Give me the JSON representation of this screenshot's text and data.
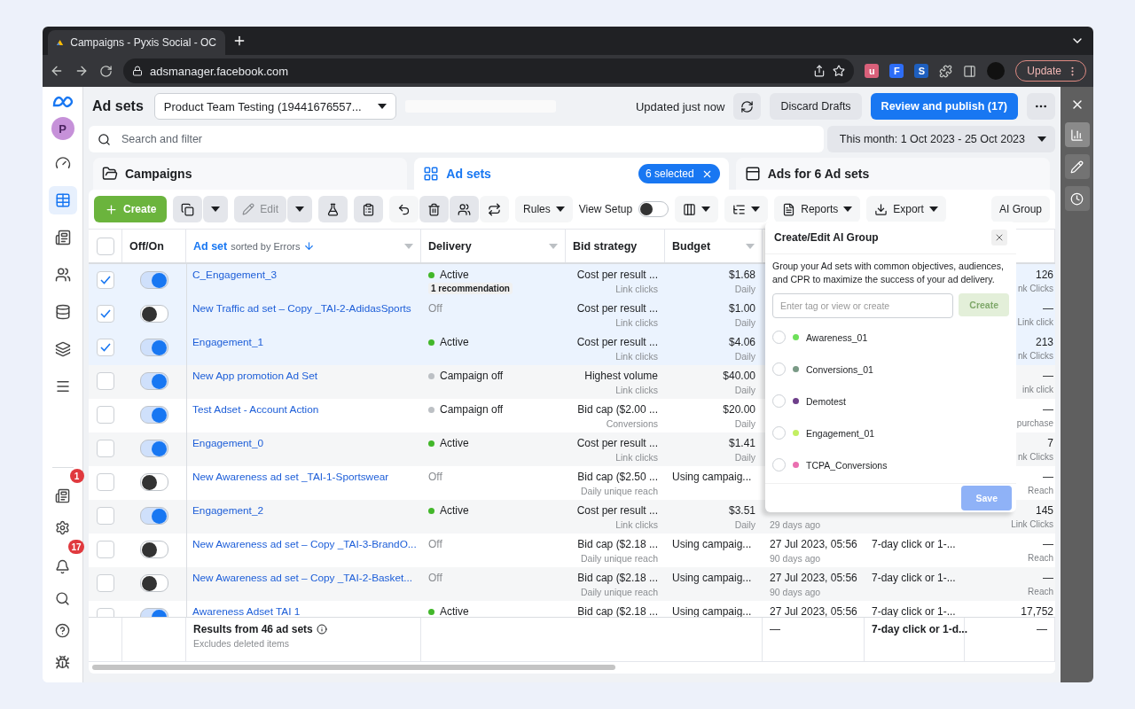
{
  "browser": {
    "tab_title": "Campaigns - Pyxis Social - OC",
    "url": "adsmanager.facebook.com",
    "extensions": [
      {
        "letter": "u",
        "color": "#d9607a"
      },
      {
        "letter": "F",
        "color": "#2d6df6"
      },
      {
        "letter": "S",
        "color": "#1e5fbf"
      }
    ],
    "update_label": "Update"
  },
  "left_nav": {
    "avatar": "P",
    "items": [
      {
        "kind": "gauge",
        "selected": false
      },
      {
        "kind": "table",
        "selected": true
      },
      {
        "kind": "news",
        "selected": false
      },
      {
        "kind": "people",
        "selected": false
      },
      {
        "kind": "coins",
        "selected": false
      },
      {
        "kind": "layers",
        "selected": false
      },
      {
        "kind": "menu",
        "selected": false
      }
    ],
    "bottom": [
      {
        "kind": "news",
        "badge": "1"
      },
      {
        "kind": "gear"
      },
      {
        "kind": "bell",
        "badge": "17"
      },
      {
        "kind": "search"
      },
      {
        "kind": "help"
      },
      {
        "kind": "bug"
      }
    ]
  },
  "top_bar": {
    "title": "Ad sets",
    "account": "Product Team Testing (19441676557...",
    "status": "Updated just now",
    "discard": "Discard Drafts",
    "publish": "Review and publish (17)"
  },
  "search": {
    "placeholder": "Search and filter",
    "date_range": "This month: 1 Oct 2023 - 25 Oct 2023"
  },
  "tabs": [
    {
      "label": "Campaigns",
      "kind": "campaigns",
      "selected": false
    },
    {
      "label": "Ad sets",
      "kind": "adsets",
      "selected": true,
      "pill": "6 selected"
    },
    {
      "label": "Ads for 6 Ad sets",
      "kind": "ads",
      "selected": false
    }
  ],
  "toolbar": {
    "create": "Create",
    "edit": "Edit",
    "rules": "Rules",
    "view_setup": {
      "label": "View Setup",
      "on": false
    },
    "reports": "Reports",
    "export": "Export",
    "ai_group": "AI Group"
  },
  "table": {
    "all_selected": false,
    "columns": [
      {
        "label": "Off/On"
      },
      {
        "label": "Ad set",
        "note": "sorted by Errors"
      },
      {
        "label": "Delivery"
      },
      {
        "label": "Bid strategy"
      },
      {
        "label": "Budget"
      }
    ],
    "rows": [
      {
        "selected": true,
        "on": true,
        "name": "C_Engagement_3",
        "kind": "active",
        "delivery": "Active",
        "recommendation": "1 recommendation",
        "bid": "Cost per result ...",
        "bid_sub": "Link clicks",
        "budget": "$1.68",
        "budget_sub": "Daily",
        "results": "126",
        "results_sub": "nk Clicks"
      },
      {
        "selected": true,
        "on": false,
        "name": "New Traffic ad set – Copy _TAI-2-AdidasSports",
        "kind": "off",
        "delivery": "Off",
        "bid": "Cost per result ...",
        "bid_sub": "Link clicks",
        "budget": "$1.00",
        "budget_sub": "Daily",
        "results": "—",
        "results_sub": "Link click"
      },
      {
        "selected": true,
        "on": true,
        "name": "Engagement_1",
        "kind": "active",
        "delivery": "Active",
        "bid": "Cost per result ...",
        "bid_sub": "Link clicks",
        "budget": "$4.06",
        "budget_sub": "Daily",
        "results": "213",
        "results_sub": "nk Clicks"
      },
      {
        "selected": false,
        "on": true,
        "name": "New App promotion Ad Set",
        "kind": "campaign_off",
        "delivery": "Campaign off",
        "bid": "Highest volume",
        "bid_sub": "Link clicks",
        "budget": "$40.00",
        "budget_sub": "Daily",
        "results": "—",
        "results_sub": "ink click"
      },
      {
        "selected": false,
        "on": true,
        "name": "Test Adset - Account Action",
        "kind": "campaign_off",
        "delivery": "Campaign off",
        "bid": "Bid cap ($2.00 ...",
        "bid_sub": "Conversions",
        "budget": "$20.00",
        "budget_sub": "Daily",
        "results": "—",
        "results_sub": "purchase"
      },
      {
        "selected": false,
        "on": true,
        "name": "Engagement_0",
        "kind": "active",
        "delivery": "Active",
        "bid": "Cost per result ...",
        "bid_sub": "Link clicks",
        "budget": "$1.41",
        "budget_sub": "Daily",
        "results": "7",
        "results_sub": "nk Clicks"
      },
      {
        "selected": false,
        "on": false,
        "name": "New Awareness ad set _TAI-1-Sportswear",
        "kind": "off",
        "delivery": "Off",
        "bid": "Bid cap ($2.50 ...",
        "bid_sub": "Daily unique reach",
        "budget": "Using campaig...",
        "results": "—",
        "results_sub": "Reach"
      },
      {
        "selected": false,
        "on": true,
        "name": "Engagement_2",
        "kind": "active",
        "delivery": "Active",
        "bid": "Cost per result ...",
        "bid_sub": "Link clicks",
        "budget": "$3.51",
        "budget_sub": "Daily",
        "date_sub": "29 days ago",
        "results": "145",
        "results_sub": "Link Clicks"
      },
      {
        "selected": false,
        "on": false,
        "name": "New Awareness ad set – Copy _TAI-3-BrandO...",
        "kind": "off",
        "delivery": "Off",
        "bid": "Bid cap ($2.18 ...",
        "bid_sub": "Daily unique reach",
        "budget": "Using campaig...",
        "date": "27 Jul 2023, 05:56",
        "date_sub": "90 days ago",
        "attribution": "7-day click or 1-...",
        "results": "—",
        "results_sub": "Reach"
      },
      {
        "selected": false,
        "on": false,
        "name": "New Awareness ad set – Copy _TAI-2-Basket...",
        "kind": "off",
        "delivery": "Off",
        "bid": "Bid cap ($2.18 ...",
        "bid_sub": "Daily unique reach",
        "budget": "Using campaig...",
        "date": "27 Jul 2023, 05:56",
        "date_sub": "90 days ago",
        "attribution": "7-day click or 1-...",
        "results": "—",
        "results_sub": "Reach"
      },
      {
        "selected": false,
        "on": true,
        "name": "Awareness Adset TAI 1",
        "kind": "active",
        "delivery": "Active",
        "bid": "Bid cap ($2.18 ...",
        "budget": "Using campaig...",
        "date": "27 Jul 2023, 05:56",
        "attribution": "7-day click or 1-...",
        "results": "17,752"
      }
    ],
    "footer": {
      "title": "Results from 46 ad sets",
      "note": "Excludes deleted items",
      "date": "—",
      "attribution": "7-day click or 1-d...",
      "results": "—"
    }
  },
  "ai_group_popup": {
    "title": "Create/Edit AI Group",
    "description": "Group your Ad sets with common objectives, audiences, and CPR to maximize the success of your ad delivery.",
    "placeholder": "Enter tag or view or create",
    "create": "Create",
    "save": "Save",
    "groups": [
      {
        "label": "Awareness_01",
        "color": "#6ee05a",
        "selected": false
      },
      {
        "label": "Conversions_01",
        "color": "#7a9a86",
        "selected": false
      },
      {
        "label": "Demotest",
        "color": "#6e3f8a",
        "selected": false
      },
      {
        "label": "Engagement_01",
        "color": "#c3ef62",
        "selected": false
      },
      {
        "label": "TCPA_Conversions",
        "color": "#ea6fb0",
        "selected": false
      }
    ]
  },
  "right_rail": [
    {
      "kind": "chart",
      "selected": true
    },
    {
      "kind": "pencil",
      "selected": false
    },
    {
      "kind": "clock",
      "selected": false
    }
  ]
}
